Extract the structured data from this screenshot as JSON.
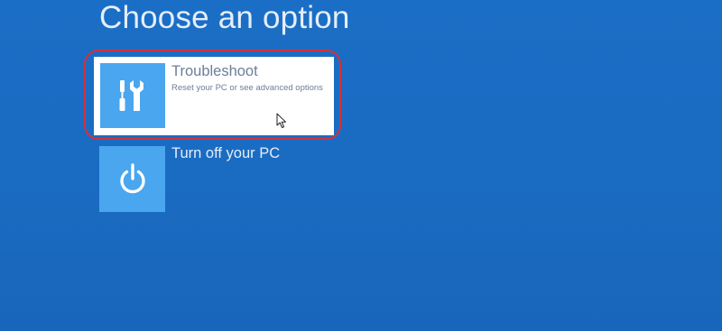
{
  "page": {
    "title": "Choose an option"
  },
  "options": [
    {
      "title": "Troubleshoot",
      "description": "Reset your PC or see advanced options",
      "icon": "tools-icon",
      "selected": true
    },
    {
      "title": "Turn off your PC",
      "icon": "power-icon",
      "selected": false
    }
  ],
  "colors": {
    "background": "#1b6ec5",
    "tile": "#4aa6ef",
    "selected_card": "#ffffff",
    "highlight": "#d4313a",
    "text_light": "#e4eefa",
    "text_muted": "#6b7f99"
  }
}
